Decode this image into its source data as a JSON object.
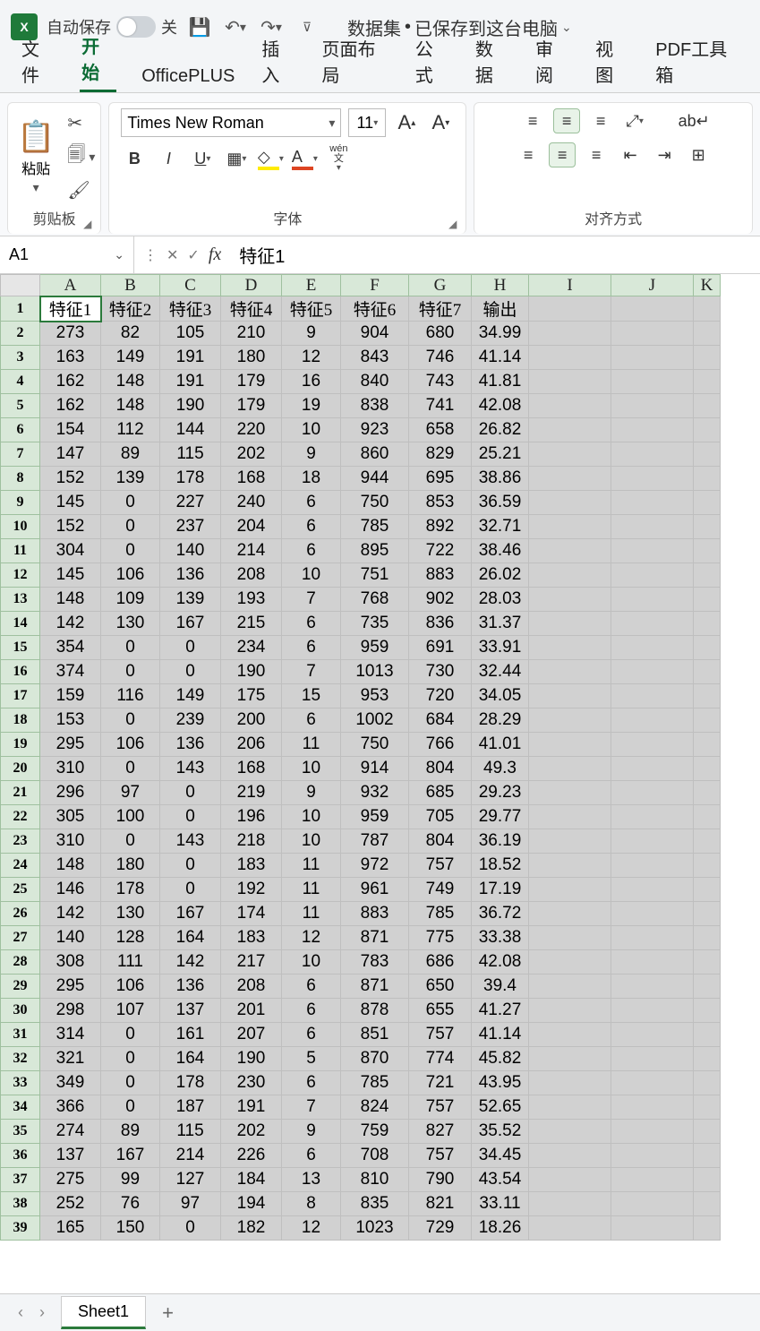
{
  "title": {
    "autosave_label": "自动保存",
    "autosave_state": "关",
    "doc_name": "数据集",
    "doc_status": "已保存到这台电脑"
  },
  "tabs": {
    "file": "文件",
    "home": "开始",
    "officeplus": "OfficePLUS",
    "insert": "插入",
    "layout": "页面布局",
    "formula": "公式",
    "data": "数据",
    "review": "审阅",
    "view": "视图",
    "pdf": "PDF工具箱"
  },
  "ribbon": {
    "clipboard": {
      "paste": "粘贴",
      "group": "剪贴板"
    },
    "font": {
      "name": "Times New Roman",
      "size": "11",
      "group": "字体",
      "wen": "wén",
      "wen2": "文"
    },
    "align": {
      "group": "对齐方式"
    }
  },
  "namebox": "A1",
  "formula": "特征1",
  "columns": [
    "A",
    "B",
    "C",
    "D",
    "E",
    "F",
    "G",
    "H",
    "I",
    "J",
    "K"
  ],
  "headers": [
    "特征1",
    "特征2",
    "特征3",
    "特征4",
    "特征5",
    "特征6",
    "特征7",
    "输出"
  ],
  "rows": [
    [
      273,
      82,
      105,
      210,
      9,
      904,
      680,
      34.99
    ],
    [
      163,
      149,
      191,
      180,
      12,
      843,
      746,
      41.14
    ],
    [
      162,
      148,
      191,
      179,
      16,
      840,
      743,
      41.81
    ],
    [
      162,
      148,
      190,
      179,
      19,
      838,
      741,
      42.08
    ],
    [
      154,
      112,
      144,
      220,
      10,
      923,
      658,
      26.82
    ],
    [
      147,
      89,
      115,
      202,
      9,
      860,
      829,
      25.21
    ],
    [
      152,
      139,
      178,
      168,
      18,
      944,
      695,
      38.86
    ],
    [
      145,
      0,
      227,
      240,
      6,
      750,
      853,
      36.59
    ],
    [
      152,
      0,
      237,
      204,
      6,
      785,
      892,
      32.71
    ],
    [
      304,
      0,
      140,
      214,
      6,
      895,
      722,
      38.46
    ],
    [
      145,
      106,
      136,
      208,
      10,
      751,
      883,
      26.02
    ],
    [
      148,
      109,
      139,
      193,
      7,
      768,
      902,
      28.03
    ],
    [
      142,
      130,
      167,
      215,
      6,
      735,
      836,
      31.37
    ],
    [
      354,
      0,
      0,
      234,
      6,
      959,
      691,
      33.91
    ],
    [
      374,
      0,
      0,
      190,
      7,
      1013,
      730,
      32.44
    ],
    [
      159,
      116,
      149,
      175,
      15,
      953,
      720,
      34.05
    ],
    [
      153,
      0,
      239,
      200,
      6,
      1002,
      684,
      28.29
    ],
    [
      295,
      106,
      136,
      206,
      11,
      750,
      766,
      41.01
    ],
    [
      310,
      0,
      143,
      168,
      10,
      914,
      804,
      49.3
    ],
    [
      296,
      97,
      0,
      219,
      9,
      932,
      685,
      29.23
    ],
    [
      305,
      100,
      0,
      196,
      10,
      959,
      705,
      29.77
    ],
    [
      310,
      0,
      143,
      218,
      10,
      787,
      804,
      36.19
    ],
    [
      148,
      180,
      0,
      183,
      11,
      972,
      757,
      18.52
    ],
    [
      146,
      178,
      0,
      192,
      11,
      961,
      749,
      17.19
    ],
    [
      142,
      130,
      167,
      174,
      11,
      883,
      785,
      36.72
    ],
    [
      140,
      128,
      164,
      183,
      12,
      871,
      775,
      33.38
    ],
    [
      308,
      111,
      142,
      217,
      10,
      783,
      686,
      42.08
    ],
    [
      295,
      106,
      136,
      208,
      6,
      871,
      650,
      39.4
    ],
    [
      298,
      107,
      137,
      201,
      6,
      878,
      655,
      41.27
    ],
    [
      314,
      0,
      161,
      207,
      6,
      851,
      757,
      41.14
    ],
    [
      321,
      0,
      164,
      190,
      5,
      870,
      774,
      45.82
    ],
    [
      349,
      0,
      178,
      230,
      6,
      785,
      721,
      43.95
    ],
    [
      366,
      0,
      187,
      191,
      7,
      824,
      757,
      52.65
    ],
    [
      274,
      89,
      115,
      202,
      9,
      759,
      827,
      35.52
    ],
    [
      137,
      167,
      214,
      226,
      6,
      708,
      757,
      34.45
    ],
    [
      275,
      99,
      127,
      184,
      13,
      810,
      790,
      43.54
    ],
    [
      252,
      76,
      97,
      194,
      8,
      835,
      821,
      33.11
    ],
    [
      165,
      150,
      0,
      182,
      12,
      1023,
      729,
      18.26
    ]
  ],
  "sheetbar": {
    "sheet1": "Sheet1"
  }
}
